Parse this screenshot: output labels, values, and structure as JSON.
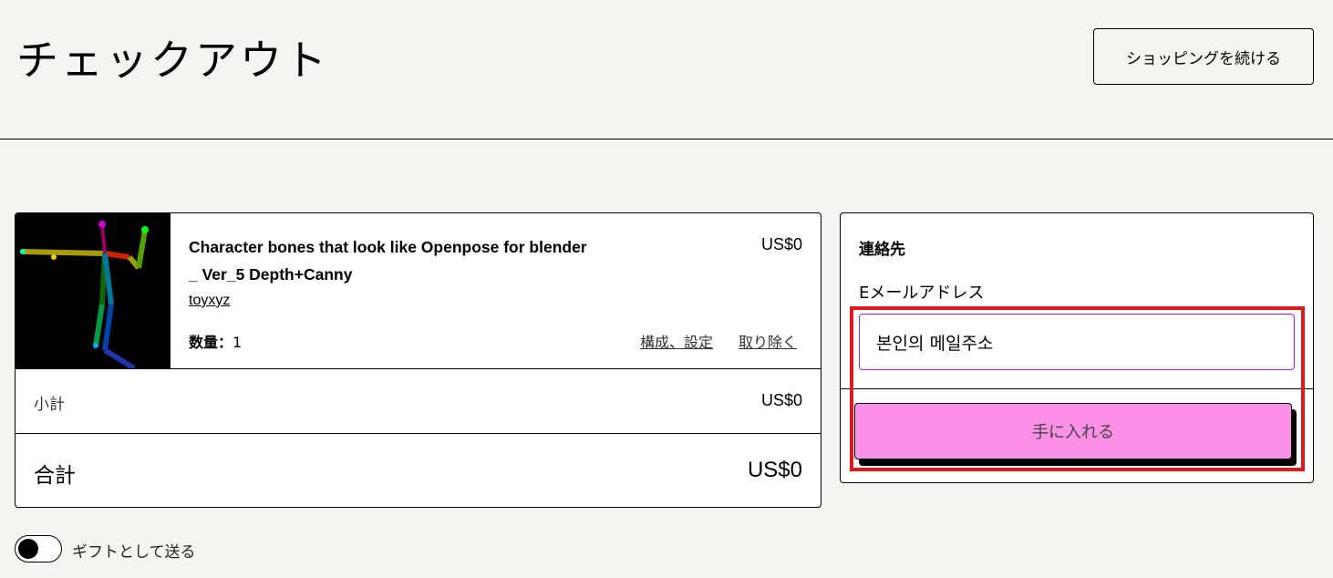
{
  "header": {
    "title": "チェックアウト",
    "continue_shopping_label": "ショッピングを続ける"
  },
  "cart": {
    "item": {
      "title": "Character bones that look like Openpose for blender _ Ver_5 Depth+Canny",
      "price": "US$0",
      "creator": "toyxyz",
      "quantity_label": "数量：",
      "quantity_value": "1",
      "configure_label": "構成、設定",
      "remove_label": "取り除く"
    },
    "subtotal_label": "小計",
    "subtotal_value": "US$0",
    "total_label": "合計",
    "total_value": "US$0"
  },
  "contact": {
    "heading": "連絡先",
    "email_label": "Eメールアドレス",
    "email_value": "본인의 메일주소",
    "buy_button_label": "手に入れる"
  },
  "gift": {
    "label": "ギフトとして送る",
    "enabled": false
  },
  "colors": {
    "accent": "#ff90e8",
    "highlight": "#e0191f",
    "background": "#f4f4f0"
  }
}
